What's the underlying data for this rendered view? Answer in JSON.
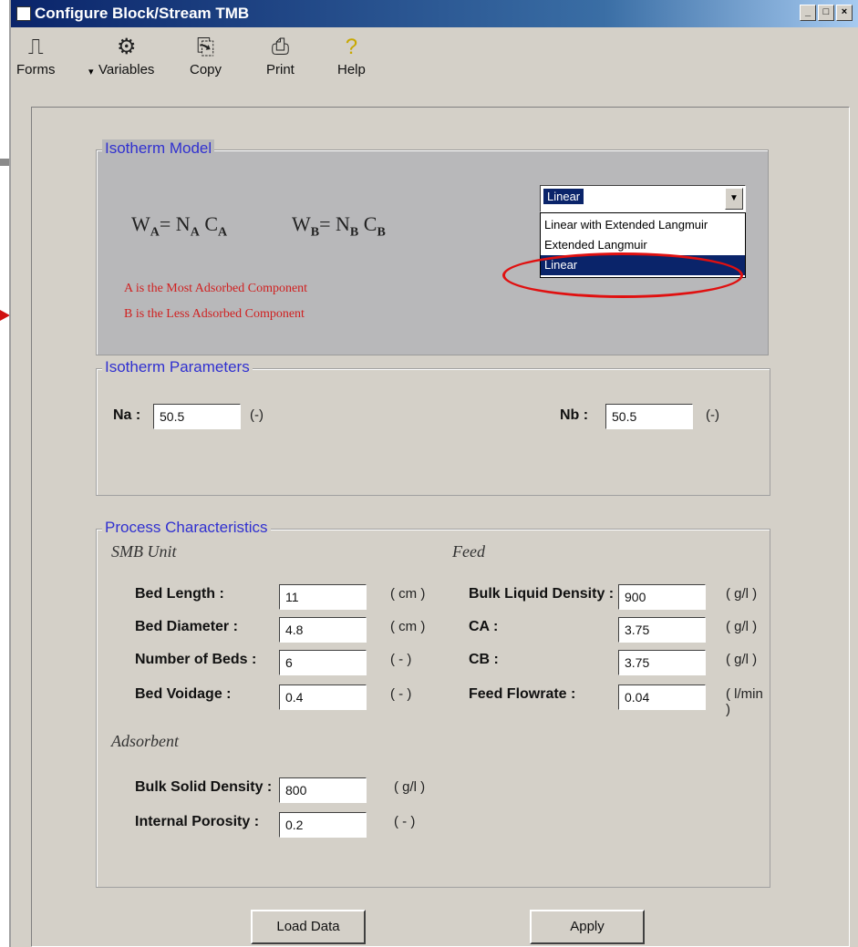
{
  "window": {
    "title": "Configure Block/Stream TMB"
  },
  "toolbar": {
    "forms": "Forms",
    "variables": "Variables",
    "copy": "Copy",
    "print": "Print",
    "help": "Help"
  },
  "isotherm_model": {
    "group_label": "Isotherm Model",
    "formula_a": {
      "w": "W",
      "ws": "A",
      "eq": "= N",
      "ns": "A",
      "c": " C",
      "cs": "A"
    },
    "formula_b": {
      "w": "W",
      "ws": "B",
      "eq": "= N",
      "ns": "B",
      "c": " C",
      "cs": "B"
    },
    "note_a": "A is the Most Adsorbed Component",
    "note_b": "B is the Less Adsorbed Component",
    "combo": {
      "selected": "Linear",
      "options": [
        "Linear with Extended Langmuir",
        "Extended Langmuir",
        "Linear"
      ],
      "highlighted_index": 2
    }
  },
  "isotherm_parameters": {
    "group_label": "Isotherm Parameters",
    "na": {
      "label": "Na :",
      "value": "50.5",
      "unit": "(-)"
    },
    "nb": {
      "label": "Nb :",
      "value": "50.5",
      "unit": "(-)"
    }
  },
  "process": {
    "group_label": "Process Characteristics",
    "smb_title": "SMB Unit",
    "feed_title": "Feed",
    "adsorbent_title": "Adsorbent",
    "bed_length": {
      "label": "Bed Length :",
      "value": "11",
      "unit": "( cm )"
    },
    "bed_diameter": {
      "label": "Bed Diameter :",
      "value": "4.8",
      "unit": "( cm )"
    },
    "num_beds": {
      "label": "Number of Beds :",
      "value": "6",
      "unit": "( - )"
    },
    "bed_voidage": {
      "label": "Bed Voidage :",
      "value": "0.4",
      "unit": "( - )"
    },
    "bulk_liquid_density": {
      "label": "Bulk Liquid Density :",
      "value": "900",
      "unit": "( g/l )"
    },
    "ca": {
      "label": "CA :",
      "value": "3.75",
      "unit": "( g/l )"
    },
    "cb": {
      "label": "CB :",
      "value": "3.75",
      "unit": "( g/l )"
    },
    "feed_flowrate": {
      "label": "Feed Flowrate :",
      "value": "0.04",
      "unit": "( l/min )"
    },
    "bulk_solid_density": {
      "label": "Bulk Solid Density :",
      "value": "800",
      "unit": "( g/l )"
    },
    "internal_porosity": {
      "label": "Internal Porosity :",
      "value": "0.2",
      "unit": "( - )"
    }
  },
  "buttons": {
    "load_data": "Load Data",
    "apply": "Apply"
  },
  "colors": {
    "title_gradient_start": "#0a246a",
    "group_label": "#3030d0",
    "note_text": "#d02020",
    "highlight": "#0a246a",
    "annotation": "#e01010"
  }
}
